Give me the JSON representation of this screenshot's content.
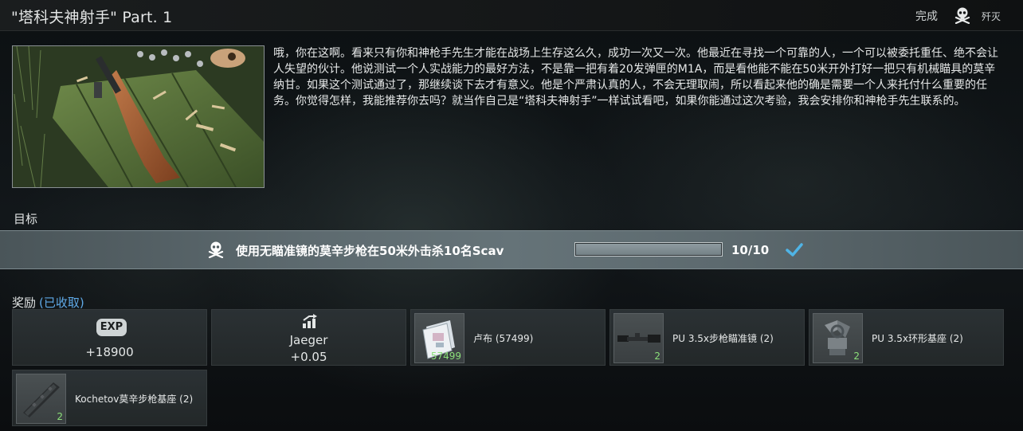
{
  "header": {
    "title": "\"塔科夫神射手\" Part. 1",
    "status": "完成",
    "quest_type": "歼灭"
  },
  "description": "哦，你在这啊。看来只有你和神枪手先生才能在战场上生存这么久，成功一次又一次。他最近在寻找一个可靠的人，一个可以被委托重任、绝不会让人失望的伙计。他说测试一个人实战能力的最好方法，不是靠一把有着20发弹匣的M1A，而是看他能不能在50米开外打好一把只有机械瞄具的莫辛纳甘。如果这个测试通过了，那继续谈下去才有意义。他是个严肃认真的人，不会无理取闹，所以看起来他的确是需要一个人来托付什么重要的任务。你觉得怎样，我能推荐你去吗？就当作自己是“塔科夫神射手”一样试试看吧，如果你能通过这次考验，我会安排你和神枪手先生联系的。",
  "objectives_label": "目标",
  "objective": {
    "text": "使用无瞄准镜的莫辛步枪在50米外击杀10名Scav",
    "progress_text": "10/10",
    "progress": 1.0
  },
  "rewards": {
    "label": "奖励",
    "claimed": "(已收取)",
    "exp": {
      "badge": "EXP",
      "value": "+18900"
    },
    "trader": {
      "name": "Jaeger",
      "value": "+0.05"
    },
    "items": [
      {
        "name": "卢布 (57499)",
        "count": "57499",
        "icon": "rubles-icon"
      },
      {
        "name": "PU 3.5x步枪瞄准镜 (2)",
        "count": "2",
        "icon": "scope-icon"
      },
      {
        "name": "PU 3.5x环形基座 (2)",
        "count": "2",
        "icon": "ring-mount-icon"
      },
      {
        "name": "Kochetov莫辛步枪基座 (2)",
        "count": "2",
        "icon": "rail-mount-icon"
      }
    ]
  },
  "colors": {
    "claimed": "#5fa9e6",
    "count": "#8be07a",
    "check": "#4fb4e6"
  }
}
